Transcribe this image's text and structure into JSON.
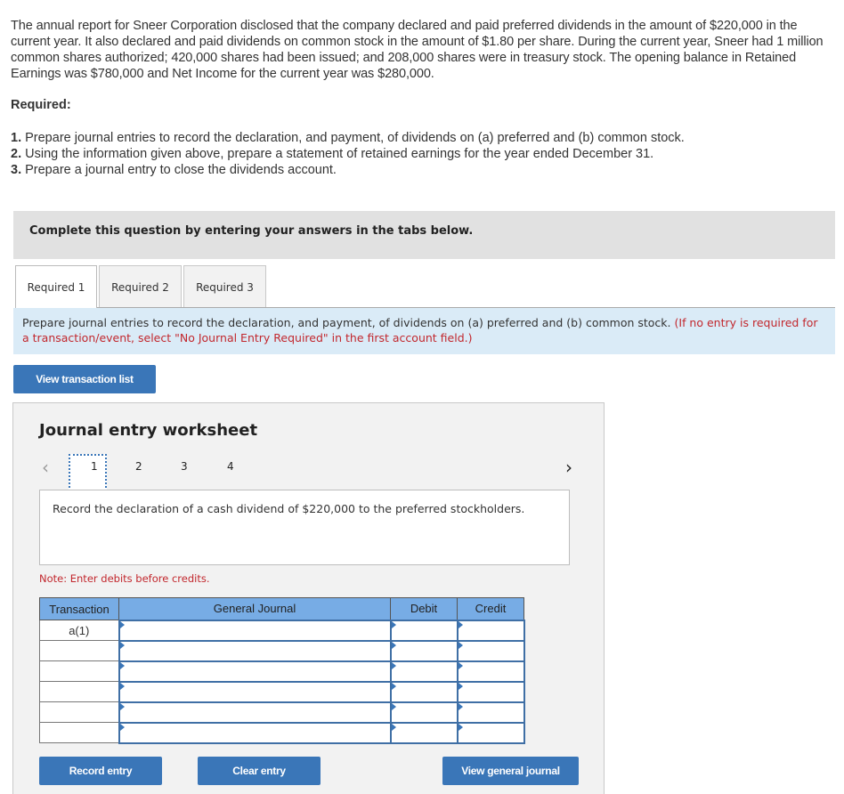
{
  "problem": {
    "intro": "The annual report for Sneer Corporation disclosed that the company declared and paid preferred dividends in the amount of $220,000 in the current year. It also declared and paid dividends on common stock in the amount of $1.80 per share. During the current year, Sneer had 1 million common shares authorized; 420,000 shares had been issued; and 208,000 shares were in treasury stock. The opening balance in Retained Earnings was $780,000 and Net Income for the current year was $280,000.",
    "required_heading": "Required:",
    "requirements": [
      {
        "num": "1.",
        "text": " Prepare journal entries to record the declaration, and payment, of dividends on (a) preferred and (b) common stock."
      },
      {
        "num": "2.",
        "text": " Using the information given above, prepare a statement of retained earnings for the year ended December 31."
      },
      {
        "num": "3.",
        "text": " Prepare a journal entry to close the dividends account."
      }
    ]
  },
  "complete_bar": "Complete this question by entering your answers in the tabs below.",
  "tabs": [
    {
      "label": "Required 1",
      "active": true
    },
    {
      "label": "Required 2",
      "active": false
    },
    {
      "label": "Required 3",
      "active": false
    }
  ],
  "instructions": {
    "main": "Prepare journal entries to record the declaration, and payment, of dividends on (a) preferred and (b) common stock. ",
    "note": "(If no entry is required for a transaction/event, select \"No Journal Entry Required\" in the first account field.)"
  },
  "view_transaction_list": "View transaction list",
  "worksheet": {
    "title": "Journal entry worksheet",
    "prev_icon": "‹",
    "next_icon": "›",
    "pages": [
      "1",
      "2",
      "3",
      "4"
    ],
    "current_page": "1",
    "description": "Record the declaration of a cash dividend of $220,000 to the preferred stockholders.",
    "note": "Note: Enter debits before credits.",
    "columns": [
      "Transaction",
      "General Journal",
      "Debit",
      "Credit"
    ],
    "rows": [
      {
        "transaction": "a(1)",
        "account": "",
        "debit": "",
        "credit": ""
      },
      {
        "transaction": "",
        "account": "",
        "debit": "",
        "credit": ""
      },
      {
        "transaction": "",
        "account": "",
        "debit": "",
        "credit": ""
      },
      {
        "transaction": "",
        "account": "",
        "debit": "",
        "credit": ""
      },
      {
        "transaction": "",
        "account": "",
        "debit": "",
        "credit": ""
      },
      {
        "transaction": "",
        "account": "",
        "debit": "",
        "credit": ""
      }
    ],
    "buttons": {
      "record": "Record entry",
      "clear": "Clear entry",
      "view_journal": "View general journal"
    }
  },
  "colors": {
    "button_blue": "#3a76b8",
    "header_blue": "#77ace5",
    "instruction_bg": "#daebf7",
    "note_red": "#c2272d"
  }
}
